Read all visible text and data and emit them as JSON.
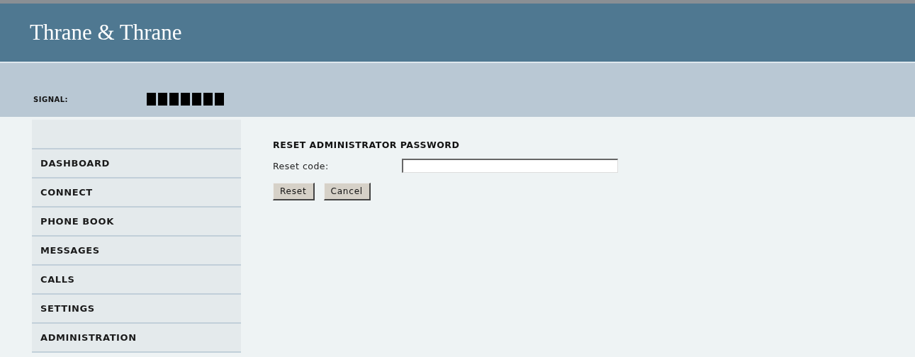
{
  "header": {
    "logo": "Thrane & Thrane"
  },
  "status": {
    "signal_label": "SIGNAL:"
  },
  "sidebar": {
    "items": [
      {
        "label": "DASHBOARD"
      },
      {
        "label": "CONNECT"
      },
      {
        "label": "PHONE BOOK"
      },
      {
        "label": "MESSAGES"
      },
      {
        "label": "CALLS"
      },
      {
        "label": "SETTINGS"
      },
      {
        "label": "ADMINISTRATION"
      }
    ]
  },
  "form": {
    "title": "RESET ADMINISTRATOR PASSWORD",
    "field_label": "Reset code:",
    "buttons": [
      "Reset",
      "Cancel"
    ]
  }
}
